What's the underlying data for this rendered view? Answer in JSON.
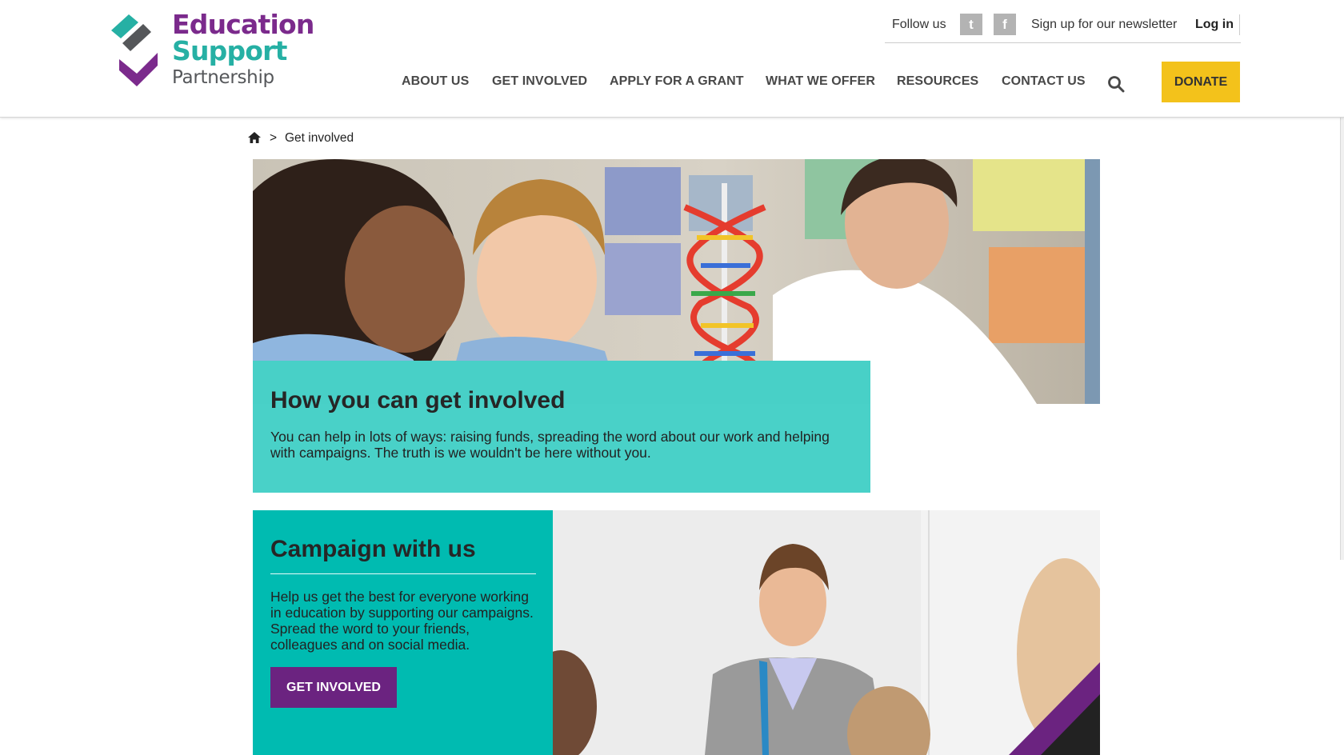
{
  "brand": {
    "line1": "Education",
    "line2": "Support",
    "line3": "Partnership"
  },
  "topbar": {
    "follow_label": "Follow us",
    "twitter_glyph": "t",
    "facebook_glyph": "f",
    "newsletter": "Sign up for our newsletter",
    "login": "Log in"
  },
  "nav": {
    "items": [
      "ABOUT US",
      "GET INVOLVED",
      "APPLY FOR A GRANT",
      "WHAT WE OFFER",
      "RESOURCES",
      "CONTACT US"
    ],
    "donate": "DONATE"
  },
  "breadcrumb": {
    "separator": ">",
    "current": "Get involved"
  },
  "hero": {
    "title": "How you can get involved",
    "text": "You can help in lots of ways: raising funds, spreading the word about our work and helping with campaigns. The truth is we wouldn't be here without you."
  },
  "campaign": {
    "title": "Campaign with us",
    "text": "Help us get the best for everyone working in education by supporting our campaigns. Spread the word to your friends, colleagues and on social media.",
    "button": "GET INVOLVED"
  },
  "colors": {
    "brand_purple": "#7b2a8c",
    "brand_teal": "#26b0a4",
    "donate_yellow": "#f3c21b",
    "hero_panel_teal": "#49d1c8",
    "campaign_teal": "#00bbb1",
    "button_purple": "#6b2380"
  }
}
